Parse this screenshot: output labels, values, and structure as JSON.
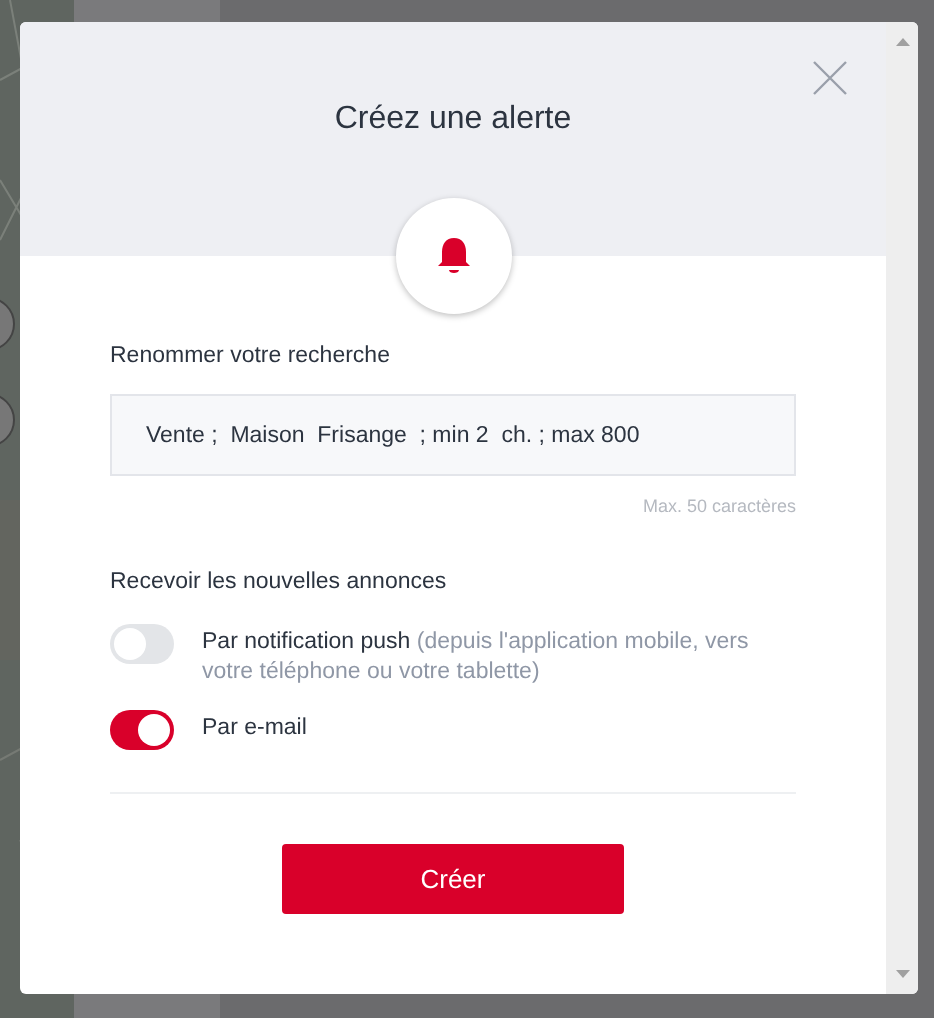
{
  "dialog": {
    "title": "Créez une alerte",
    "rename": {
      "label": "Renommer votre recherche",
      "value": "Vente ;  Maison  Frisange  ; min 2  ch. ; max 800",
      "hint": "Max. 50 caractères"
    },
    "receive": {
      "label": "Recevoir les nouvelles annonces",
      "options": [
        {
          "label": "Par notification push",
          "note": "(depuis l'application mobile, vers votre téléphone ou votre tablette)",
          "on": false
        },
        {
          "label": "Par e-mail",
          "on": true
        }
      ]
    },
    "submit": "Créer"
  }
}
